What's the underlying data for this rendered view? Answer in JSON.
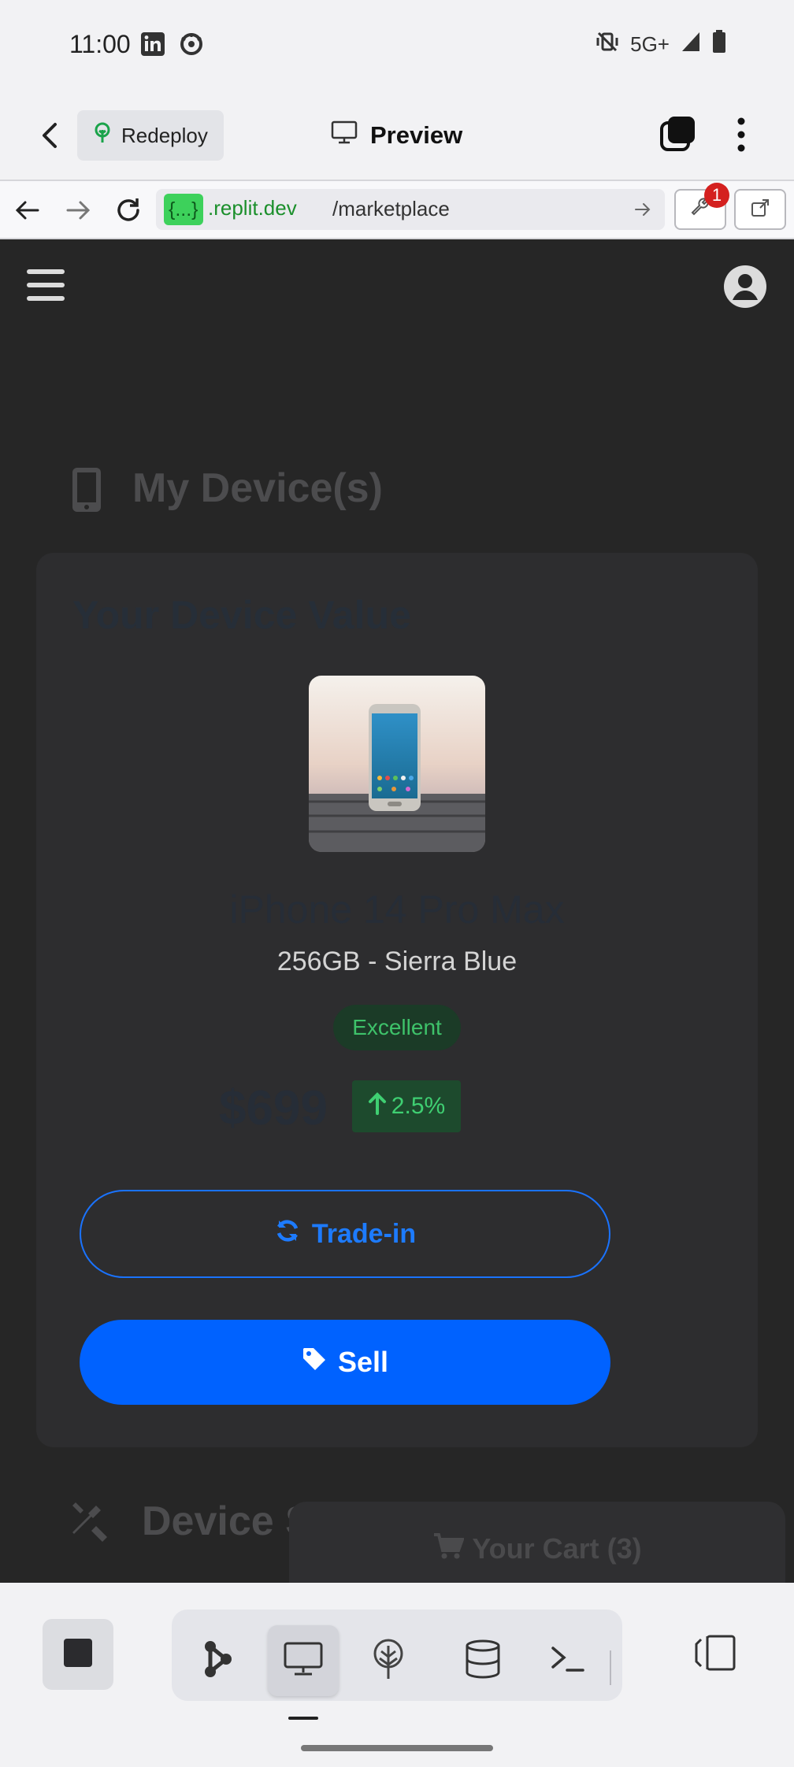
{
  "status_bar": {
    "time": "11:00",
    "network": "5G+",
    "icons": [
      "linkedin-icon",
      "cloud-sync-icon",
      "vibrate-off-icon",
      "signal-icon",
      "battery-icon"
    ]
  },
  "app_header": {
    "redeploy_label": "Redeploy",
    "preview_label": "Preview"
  },
  "url_bar": {
    "host_badge": "{...}",
    "host": ".replit.dev",
    "path": "/marketplace",
    "devtools_badge": "1"
  },
  "page": {
    "my_devices_title": "My Device(s)",
    "card_title": "Your Device Value",
    "device_name": "iPhone 14 Pro Max",
    "device_spec": "256GB - Sierra Blue",
    "condition": "Excellent",
    "price": "$699",
    "change": "2.5%",
    "tradein_label": "Trade-in",
    "sell_label": "Sell",
    "next_section_title": "Device S",
    "cart_label": "Your Cart (3)"
  },
  "colors": {
    "accent": "#0062ff",
    "positive": "#3ec26a",
    "background": "#262626"
  }
}
